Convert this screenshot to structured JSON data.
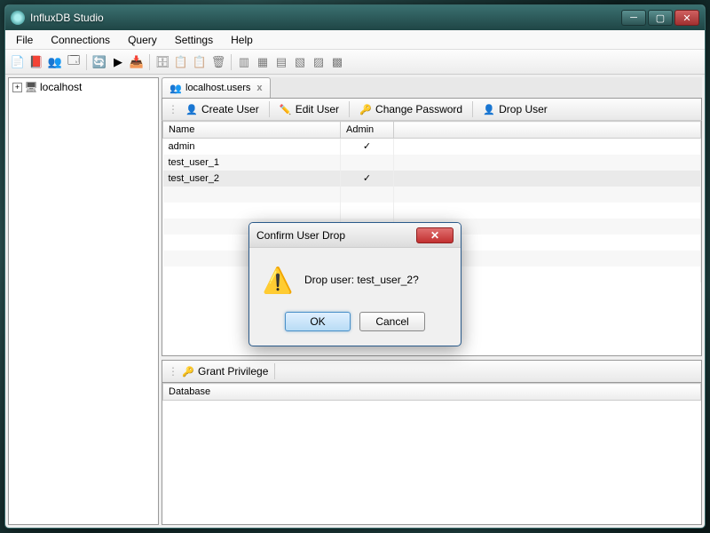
{
  "window": {
    "title": "InfluxDB Studio"
  },
  "menu": {
    "file": "File",
    "connections": "Connections",
    "query": "Query",
    "settings": "Settings",
    "help": "Help"
  },
  "sidebar": {
    "rootNode": "localhost"
  },
  "tab": {
    "label": "localhost.users"
  },
  "actions": {
    "createUser": "Create User",
    "editUser": "Edit User",
    "changePassword": "Change Password",
    "dropUser": "Drop User",
    "grantPrivilege": "Grant Privilege"
  },
  "grid": {
    "colName": "Name",
    "colAdmin": "Admin",
    "rows": [
      {
        "name": "admin",
        "admin": "✓"
      },
      {
        "name": "test_user_1",
        "admin": ""
      },
      {
        "name": "test_user_2",
        "admin": "✓"
      }
    ]
  },
  "lowerGrid": {
    "colDatabase": "Database"
  },
  "dialog": {
    "title": "Confirm User Drop",
    "message": "Drop user: test_user_2?",
    "ok": "OK",
    "cancel": "Cancel"
  }
}
